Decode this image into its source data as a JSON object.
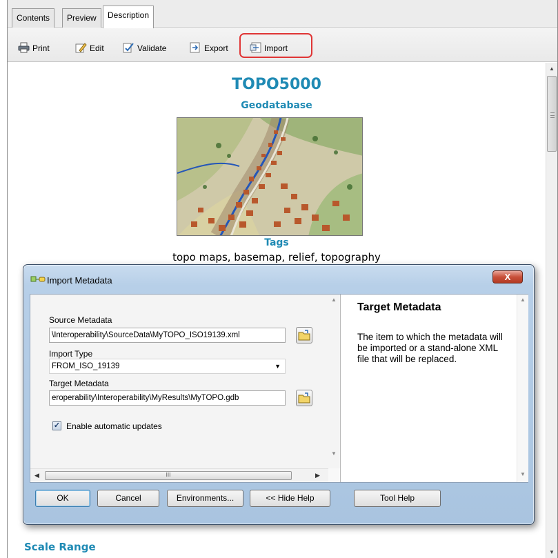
{
  "tabs": [
    {
      "label": "Contents"
    },
    {
      "label": "Preview"
    },
    {
      "label": "Description",
      "active": true
    }
  ],
  "toolbar": {
    "print_label": "Print",
    "edit_label": "Edit",
    "validate_label": "Validate",
    "export_label": "Export",
    "import_label": "Import",
    "import_highlight_color": "#e03535"
  },
  "description": {
    "title": "TOPO5000",
    "subtitle": "Geodatabase",
    "thumbnail_icon": "topographic-map-thumbnail",
    "tags_heading": "Tags",
    "tags": "topo maps, basemap, relief, topography",
    "scale_range_heading": "Scale Range",
    "accent_color": "#1f8ab4"
  },
  "dialog": {
    "title": "Import Metadata",
    "close_label": "X",
    "source_label": "Source Metadata",
    "source_value": "\\Interoperability\\SourceData\\MyTOPO_ISO19139.xml",
    "import_type_label": "Import Type",
    "import_type_value": "FROM_ISO_19139",
    "target_label": "Target Metadata",
    "target_value": "eroperability\\Interoperability\\MyResults\\MyTOPO.gdb",
    "checkbox_label": "Enable automatic updates",
    "checkbox_checked": true,
    "help_title": "Target Metadata",
    "help_text": "The item to which the metadata will be imported or a stand-alone XML file that will be replaced.",
    "scroll_grip": "III",
    "buttons": {
      "ok": "OK",
      "cancel": "Cancel",
      "environments": "Environments...",
      "hide_help": "<< Hide Help",
      "tool_help": "Tool Help"
    }
  }
}
